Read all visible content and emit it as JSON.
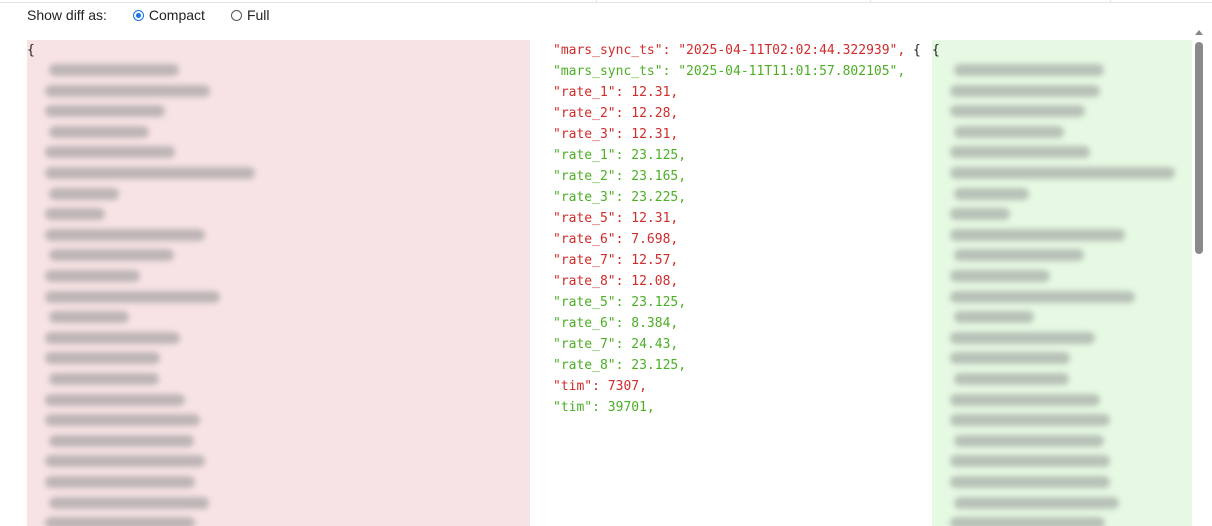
{
  "options": {
    "label": "Show diff as:",
    "choices": [
      {
        "label": "Compact",
        "checked": true
      },
      {
        "label": "Full",
        "checked": false
      }
    ]
  },
  "left_pane": {
    "open_brace": "{"
  },
  "right_pane": {
    "open_brace": "{"
  },
  "diff_lines": [
    {
      "type": "removed",
      "text": "\"mars_sync_ts\": \"2025-04-11T02:02:44.322939\",",
      "tail": " {"
    },
    {
      "type": "added",
      "text": "\"mars_sync_ts\": \"2025-04-11T11:01:57.802105\","
    },
    {
      "type": "removed",
      "text": "\"rate_1\": 12.31,"
    },
    {
      "type": "removed",
      "text": "\"rate_2\": 12.28,"
    },
    {
      "type": "removed",
      "text": "\"rate_3\": 12.31,"
    },
    {
      "type": "added",
      "text": "\"rate_1\": 23.125,"
    },
    {
      "type": "added",
      "text": "\"rate_2\": 23.165,"
    },
    {
      "type": "added",
      "text": "\"rate_3\": 23.225,"
    },
    {
      "type": "removed",
      "text": "\"rate_5\": 12.31,"
    },
    {
      "type": "removed",
      "text": "\"rate_6\": 7.698,"
    },
    {
      "type": "removed",
      "text": "\"rate_7\": 12.57,"
    },
    {
      "type": "removed",
      "text": "\"rate_8\": 12.08,"
    },
    {
      "type": "added",
      "text": "\"rate_5\": 23.125,"
    },
    {
      "type": "added",
      "text": "\"rate_6\": 8.384,"
    },
    {
      "type": "added",
      "text": "\"rate_7\": 24.43,"
    },
    {
      "type": "added",
      "text": "\"rate_8\": 23.125,"
    },
    {
      "type": "removed",
      "text": "\"tim\": 7307,"
    },
    {
      "type": "added",
      "text": "\"tim\": 39701,"
    }
  ],
  "colors": {
    "removed_text": "#d12b2b",
    "added_text": "#4caf25",
    "removed_bg": "#f8e3e4",
    "added_bg": "#e6f9e3",
    "radio_accent": "#1a73e8"
  }
}
